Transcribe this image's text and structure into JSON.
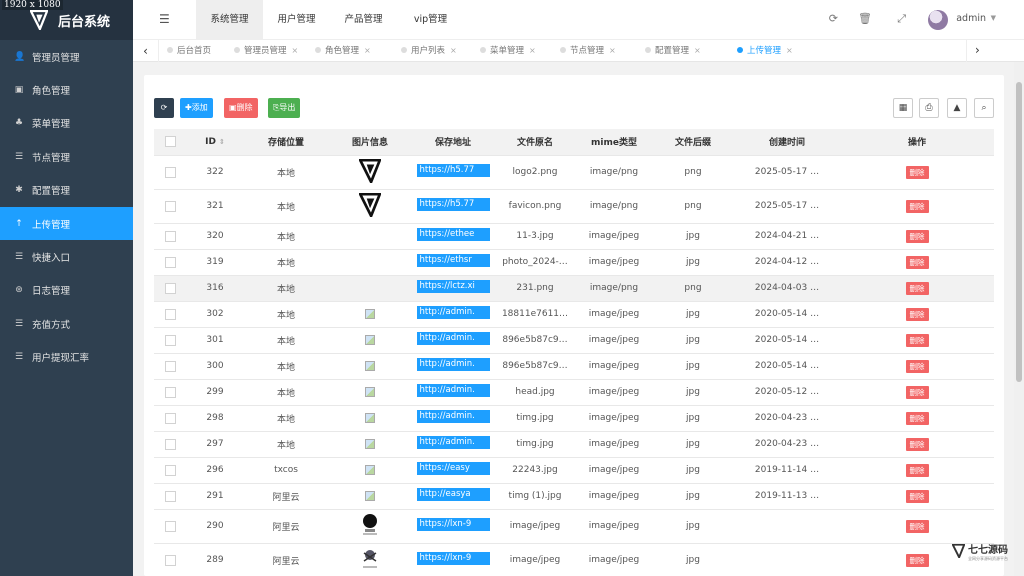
{
  "resolution_badge": "1920 x 1080",
  "brand": {
    "title": "后台系统"
  },
  "sidebar": {
    "items": [
      {
        "label": "管理员管理",
        "icon": "user-icon",
        "glyph": "👤"
      },
      {
        "label": "角色管理",
        "icon": "role-icon",
        "glyph": "▣"
      },
      {
        "label": "菜单管理",
        "icon": "tree-icon",
        "glyph": "♣"
      },
      {
        "label": "节点管理",
        "icon": "list-icon",
        "glyph": "☰"
      },
      {
        "label": "配置管理",
        "icon": "gear-icon",
        "glyph": "✱"
      },
      {
        "label": "上传管理",
        "icon": "upload-icon",
        "glyph": "↑",
        "active": true
      },
      {
        "label": "快捷入口",
        "icon": "list-icon",
        "glyph": "☰"
      },
      {
        "label": "日志管理",
        "icon": "log-icon",
        "glyph": "⊛"
      },
      {
        "label": "充值方式",
        "icon": "list-icon",
        "glyph": "☰"
      },
      {
        "label": "用户提现汇率",
        "icon": "list-icon",
        "glyph": "☰"
      }
    ]
  },
  "header": {
    "tabs": [
      "系统管理",
      "用户管理",
      "产品管理",
      "vip管理"
    ],
    "active_tab": 0,
    "user": "admin"
  },
  "page_tabs": [
    {
      "label": "后台首页",
      "closable": false
    },
    {
      "label": "管理员管理",
      "closable": true
    },
    {
      "label": "角色管理",
      "closable": true
    },
    {
      "label": "用户列表",
      "closable": true
    },
    {
      "label": "菜单管理",
      "closable": true
    },
    {
      "label": "节点管理",
      "closable": true
    },
    {
      "label": "配置管理",
      "closable": true
    },
    {
      "label": "上传管理",
      "closable": true,
      "active": true
    }
  ],
  "toolbar": {
    "add": "添加",
    "delete": "删除",
    "export": "导出"
  },
  "table": {
    "headers": [
      "ID",
      "存储位置",
      "图片信息",
      "保存地址",
      "文件原名",
      "mime类型",
      "文件后缀",
      "创建时间",
      "操作"
    ],
    "delete_label": "删除",
    "rows": [
      {
        "id": "322",
        "storage": "本地",
        "image": "logo",
        "url": "https://h5.77",
        "name": "logo2.png",
        "mime": "image/png",
        "ext": "png",
        "time": "2025-05-17 …",
        "tall": true
      },
      {
        "id": "321",
        "storage": "本地",
        "image": "logo",
        "url": "https://h5.77",
        "name": "favicon.png",
        "mime": "image/png",
        "ext": "png",
        "time": "2025-05-17 …",
        "tall": true
      },
      {
        "id": "320",
        "storage": "本地",
        "image": "",
        "url": "https://ethee",
        "name": "11-3.jpg",
        "mime": "image/jpeg",
        "ext": "jpg",
        "time": "2024-04-21 …"
      },
      {
        "id": "319",
        "storage": "本地",
        "image": "",
        "url": "https://ethsr",
        "name": "photo_2024-…",
        "mime": "image/jpeg",
        "ext": "jpg",
        "time": "2024-04-12 …"
      },
      {
        "id": "316",
        "storage": "本地",
        "image": "",
        "url": "https://lctz.xi",
        "name": "231.png",
        "mime": "image/png",
        "ext": "png",
        "time": "2024-04-03 …",
        "highlight": true
      },
      {
        "id": "302",
        "storage": "本地",
        "image": "broken",
        "url": "http://admin.",
        "name": "18811e7611…",
        "mime": "image/jpeg",
        "ext": "jpg",
        "time": "2020-05-14 …"
      },
      {
        "id": "301",
        "storage": "本地",
        "image": "broken",
        "url": "http://admin.",
        "name": "896e5b87c9…",
        "mime": "image/jpeg",
        "ext": "jpg",
        "time": "2020-05-14 …"
      },
      {
        "id": "300",
        "storage": "本地",
        "image": "broken",
        "url": "http://admin.",
        "name": "896e5b87c9…",
        "mime": "image/jpeg",
        "ext": "jpg",
        "time": "2020-05-14 …"
      },
      {
        "id": "299",
        "storage": "本地",
        "image": "broken",
        "url": "http://admin.",
        "name": "head.jpg",
        "mime": "image/jpeg",
        "ext": "jpg",
        "time": "2020-05-12 …"
      },
      {
        "id": "298",
        "storage": "本地",
        "image": "broken",
        "url": "http://admin.",
        "name": "timg.jpg",
        "mime": "image/jpeg",
        "ext": "jpg",
        "time": "2020-04-23 …"
      },
      {
        "id": "297",
        "storage": "本地",
        "image": "broken",
        "url": "http://admin.",
        "name": "timg.jpg",
        "mime": "image/jpeg",
        "ext": "jpg",
        "time": "2020-04-23 …"
      },
      {
        "id": "296",
        "storage": "txcos",
        "image": "broken",
        "url": "https://easy",
        "name": "22243.jpg",
        "mime": "image/jpeg",
        "ext": "jpg",
        "time": "2019-11-14 …"
      },
      {
        "id": "291",
        "storage": "阿里云",
        "image": "broken",
        "url": "http://easya",
        "name": "timg (1).jpg",
        "mime": "image/jpeg",
        "ext": "jpg",
        "time": "2019-11-13 …"
      },
      {
        "id": "290",
        "storage": "阿里云",
        "image": "avatar",
        "url": "https://lxn-9",
        "name": "image/jpeg",
        "mime": "image/jpeg",
        "ext": "jpg",
        "time": "",
        "tall": true
      },
      {
        "id": "289",
        "storage": "阿里云",
        "image": "avatar2",
        "url": "https://lxn-9",
        "name": "image/jpeg",
        "mime": "image/jpeg",
        "ext": "jpg",
        "time": "",
        "tall": true
      }
    ]
  },
  "watermark": {
    "title": "七七源码",
    "subtitle": "全网分享源码资源平台"
  }
}
